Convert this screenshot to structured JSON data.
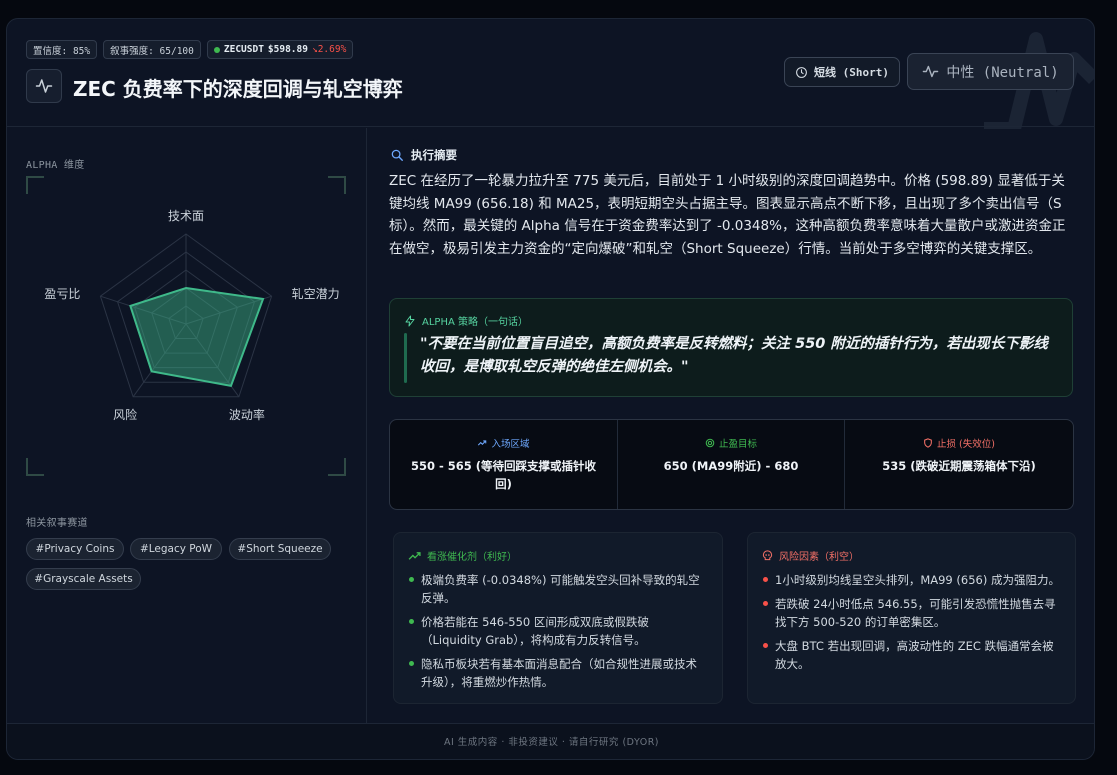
{
  "header": {
    "confidence": "置信度: 85%",
    "narrative_strength": "叙事强度: 65/100",
    "ticker": "ZECUSDT",
    "price": "$598.89",
    "change": "↘2.69%",
    "title": "ZEC 负费率下的深度回调与轧空博弈",
    "timeframe_label": "短线 (Short)",
    "sentiment_label": "中性 (Neutral)"
  },
  "left": {
    "alpha_dimension_label": "ALPHA 维度",
    "radar": {
      "axes": [
        "技术面",
        "轧空潜力",
        "波动率",
        "风险",
        "盈亏比"
      ],
      "values": [
        0.4,
        0.9,
        0.85,
        0.65,
        0.65
      ],
      "color": "#3fb98a"
    },
    "tags_label": "相关叙事赛道",
    "tags": [
      "#Privacy Coins",
      "#Legacy PoW",
      "#Short Squeeze",
      "#Grayscale Assets"
    ]
  },
  "summary": {
    "heading": "执行摘要",
    "text": "ZEC 在经历了一轮暴力拉升至 775 美元后，目前处于 1 小时级别的深度回调趋势中。价格 (598.89) 显著低于关键均线 MA99 (656.18) 和 MA25，表明短期空头占据主导。图表显示高点不断下移，且出现了多个卖出信号（S标）。然而，最关键的 Alpha 信号在于资金费率达到了 -0.0348%，这种高额负费率意味着大量散户或激进资金正在做空，极易引发主力资金的“定向爆破”和轧空（Short Squeeze）行情。当前处于多空博弈的关键支撑区。"
  },
  "alpha_strategy": {
    "heading": "ALPHA 策略（一句话）",
    "text": "\"不要在当前位置盲目追空，高额负费率是反转燃料；关注 550 附近的插针行为，若出现长下影线收回，是博取轧空反弹的绝佳左侧机会。\""
  },
  "zones": [
    {
      "label": "入场区域",
      "value": "550 - 565 (等待回踩支撑或插针收回)",
      "color": "#6ea8fe"
    },
    {
      "label": "止盈目标",
      "value": "650 (MA99附近) - 680",
      "color": "#3fb950"
    },
    {
      "label": "止损 (失效位)",
      "value": "535 (跌破近期震荡箱体下沿)",
      "color": "#f47067"
    }
  ],
  "catalysts": {
    "heading": "看涨催化剂（利好）",
    "color": "#3fb950",
    "items": [
      "极端负费率 (-0.0348%) 可能触发空头回补导致的轧空反弹。",
      "价格若能在 546-550 区间形成双底或假跌破（Liquidity Grab），将构成有力反转信号。",
      "隐私币板块若有基本面消息配合（如合规性进展或技术升级），将重燃炒作热情。"
    ]
  },
  "risks": {
    "heading": "风险因素（利空）",
    "color": "#f47067",
    "items": [
      "1小时级别均线呈空头排列，MA99 (656) 成为强阻力。",
      "若跌破 24小时低点 546.55，可能引发恐慌性抛售去寻找下方 500-520 的订单密集区。",
      "大盘 BTC 若出现回调，高波动性的 ZEC 跌幅通常会被放大。"
    ]
  },
  "footer": "AI 生成内容 · 非投资建议 · 请自行研究 (DYOR)"
}
